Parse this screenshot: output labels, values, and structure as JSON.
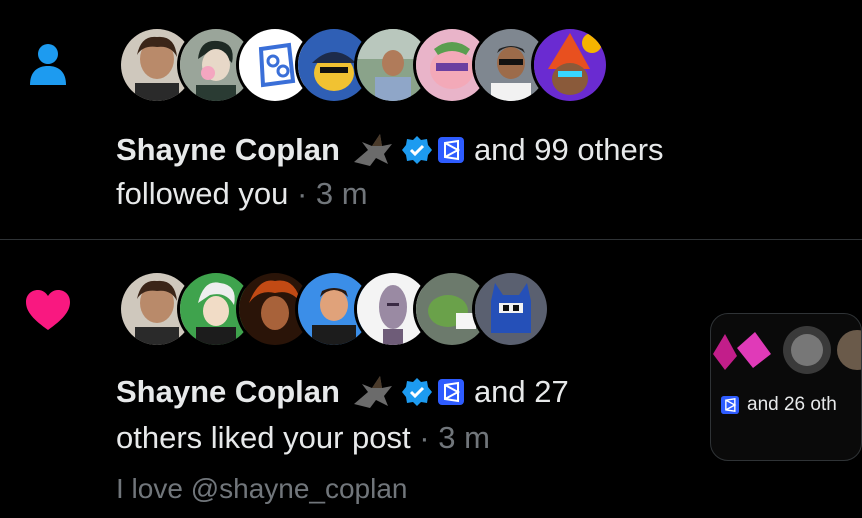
{
  "colors": {
    "background": "#000000",
    "follow_icon": "#1d9bf0",
    "like_icon": "#f91880",
    "muted_text": "#71767b",
    "text": "#e7e9ea",
    "verified": "#1d9bf0"
  },
  "notifications": [
    {
      "type": "follow",
      "icon": "person-icon",
      "avatars": [
        "avatar-curly-hair-man",
        "avatar-anime-bubblegum",
        "avatar-hexagon-logo",
        "avatar-blue-cap-character",
        "avatar-man-outdoors",
        "avatar-pink-pig",
        "avatar-man-sunglasses",
        "avatar-wizard-colorful"
      ],
      "name": "Shayne Coplan",
      "name_emoji": "eagle-emoji",
      "others": "and 99 others",
      "action": "followed you",
      "separator": "·",
      "time": "3 m"
    },
    {
      "type": "like",
      "icon": "heart-icon",
      "avatars": [
        "avatar-curly-hair-man",
        "avatar-white-hair-anime",
        "avatar-fire-warrior",
        "avatar-cartoon-guy",
        "avatar-bald-man-art",
        "avatar-pepe-frog",
        "avatar-blue-cat"
      ],
      "name": "Shayne Coplan",
      "name_emoji": "eagle-emoji",
      "others": "and 27",
      "action": "others liked your post",
      "separator": "·",
      "time": "3 m",
      "post_text": "I love @shayne_coplan"
    }
  ],
  "preview": {
    "text": "and 26 oth"
  }
}
